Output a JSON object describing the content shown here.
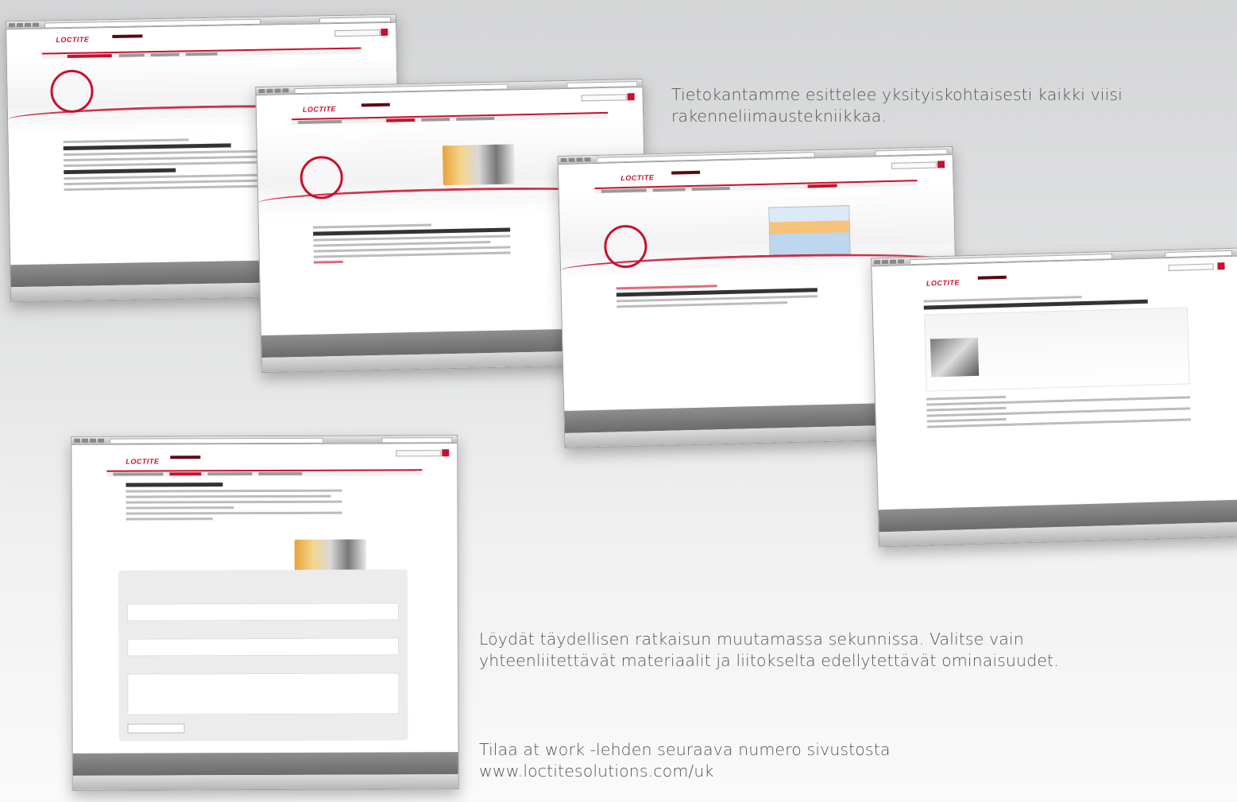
{
  "captions": {
    "database": "Tietokantamme esittelee yksityiskohtaisesti kaikki viisi rakenneliimaustekniikkaa.",
    "solution": "Löydät täydellisen ratkaisun muutamassa sekunnissa. Valitse vain yhteenliitettävät materiaalit ja liitokselta edellytettävät ominaisuudet.",
    "subscribe": "Tilaa at work -lehden seuraava numero sivustosta www.loctitesolutions.com/uk"
  },
  "brand": {
    "name": "LOCTITE",
    "accent": "#c8102e",
    "dark": "#5a0a14"
  },
  "screenshots": [
    {
      "id": "intro-page"
    },
    {
      "id": "technologies-page"
    },
    {
      "id": "selector-chart-page"
    },
    {
      "id": "product-detail-page"
    },
    {
      "id": "solution-finder-form"
    }
  ]
}
